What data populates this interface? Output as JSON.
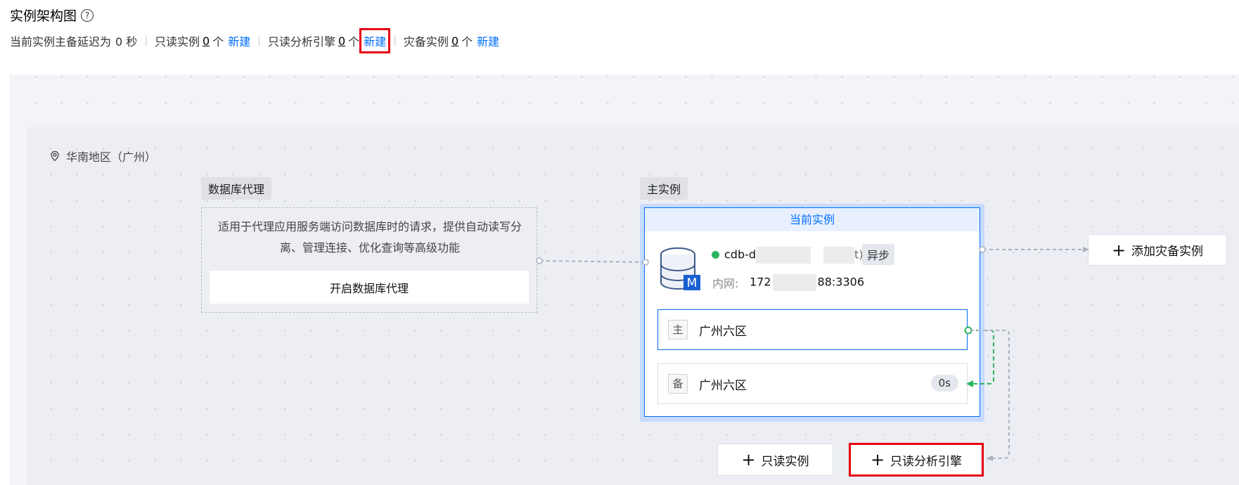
{
  "header": {
    "title": "实例架构图",
    "help_icon": "question-circle-icon"
  },
  "summary": {
    "delay_label": "当前实例主备延迟为",
    "delay_value": "0 秒",
    "readonly_label": "只读实例",
    "readonly_count": "0",
    "readonly_unit": "个",
    "readonly_create": "新建",
    "analytics_label": "只读分析引擎",
    "analytics_count": "0",
    "analytics_unit": "个",
    "analytics_create": "新建",
    "disaster_label": "灾备实例",
    "disaster_count": "0",
    "disaster_unit": "个",
    "disaster_create": "新建"
  },
  "region": {
    "icon": "location-pin-icon",
    "label": "华南地区（广州）"
  },
  "proxy": {
    "tag": "数据库代理",
    "description": "适用于代理应用服务端访问数据库时的请求，提供自动读写分离、管理连接、优化查询等高级功能",
    "enable_button": "开启数据库代理"
  },
  "master": {
    "tag": "主实例",
    "header": "当前实例",
    "instance_id_prefix": "cdb-d",
    "instance_id_suffix": "t)",
    "status_color": "#2ab55f",
    "sync_mode": "异步",
    "network_label": "内网:",
    "network_prefix": "172",
    "network_suffix": "88:3306",
    "icon_badge": "M",
    "zones": [
      {
        "role": "主",
        "name": "广州六区"
      },
      {
        "role": "备",
        "name": "广州六区",
        "lag": "0s"
      }
    ]
  },
  "actions": {
    "add_disaster": "添加灾备实例",
    "add_readonly": "只读实例",
    "add_analytics": "只读分析引擎"
  },
  "colors": {
    "accent": "#006eff",
    "highlight": "#e60012",
    "sync_line": "#2ab55f"
  }
}
